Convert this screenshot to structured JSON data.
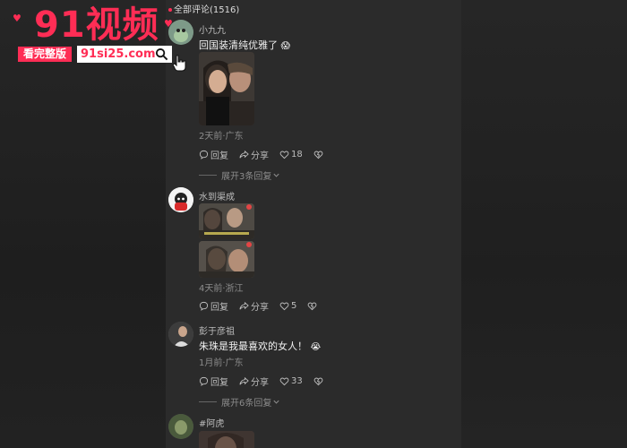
{
  "watermark": {
    "title": "91视频",
    "badge": "看完整版",
    "url": "91si25.com",
    "brand_color": "#ff2d55"
  },
  "header": {
    "label": "全部评论(1516)"
  },
  "comments": [
    {
      "username": "小九九",
      "text": "回国装清纯优雅了",
      "emoji": "😱",
      "meta": "2天前·广东",
      "reply": "回复",
      "share": "分享",
      "likes": "18",
      "expand": "展开3条回复"
    },
    {
      "username": "水到渠成",
      "meta": "4天前·浙江",
      "reply": "回复",
      "share": "分享",
      "likes": "5"
    },
    {
      "username": "彭于彦祖",
      "text": "朱珠是我最喜欢的女人！",
      "emoji": "😭",
      "meta": "1月前·广东",
      "reply": "回复",
      "share": "分享",
      "likes": "33",
      "expand": "展开6条回复"
    },
    {
      "username": "#阿虎"
    }
  ],
  "icons": {
    "reply": "speech-bubble-icon",
    "share": "share-arrow-icon",
    "like": "heart-icon",
    "dislike": "broken-heart-icon",
    "expand": "chevron-down-icon",
    "search": "search-icon",
    "hand": "pointer-hand-icon"
  }
}
